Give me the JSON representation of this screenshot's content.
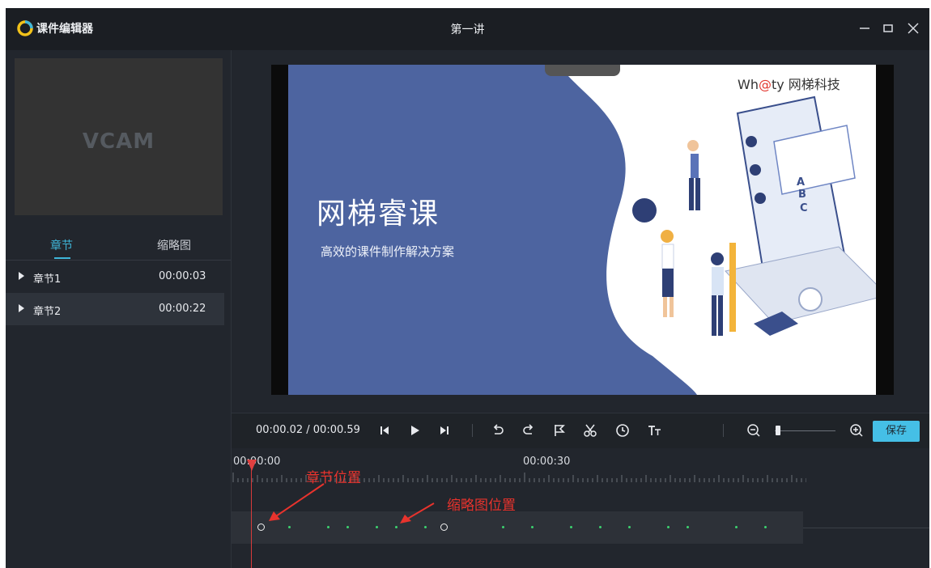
{
  "window": {
    "app_name": "课件编辑器",
    "title": "第一讲",
    "minimize_icon": "minimize-icon",
    "maximize_icon": "maximize-icon",
    "close_icon": "close-icon"
  },
  "preview": {
    "camera_label": "VCAM"
  },
  "tabs": [
    {
      "label": "章节",
      "active": true
    },
    {
      "label": "缩略图",
      "active": false
    }
  ],
  "chapters": [
    {
      "name": "章节1",
      "time": "00:00:03",
      "selected": false
    },
    {
      "name": "章节2",
      "time": "00:00:22",
      "selected": true
    }
  ],
  "slide": {
    "brand_prefix": "Wh",
    "brand_at": "@",
    "brand_suffix": "ty 网梯科技",
    "title": "网梯睿课",
    "subtitle": "高效的课件制作解决方案",
    "illustration_letters": [
      "A",
      "B",
      "C"
    ]
  },
  "toolbar": {
    "timecode": "00:00.02 / 00:00.59",
    "buttons": [
      "prev-frame-icon",
      "play-icon",
      "next-frame-icon",
      "undo-icon",
      "redo-icon",
      "flag-icon",
      "scissors-icon",
      "clock-icon",
      "text-icon",
      "zoom-out-icon",
      "zoom-in-icon"
    ],
    "zoom_level": 0.05,
    "save_label": "保存"
  },
  "timeline": {
    "start_label": "00:00:00",
    "mid_label": "00:00:30",
    "chapter_annotation": "章节位置",
    "thumbnail_annotation": "缩略图位置"
  },
  "colors": {
    "accent": "#3fb6d9",
    "save_button": "#45bfe6",
    "playhead": "#e04040",
    "annotation": "#e8332d",
    "thumbnail_marker": "#3cd16f",
    "slide_blue": "#4d64a0"
  }
}
